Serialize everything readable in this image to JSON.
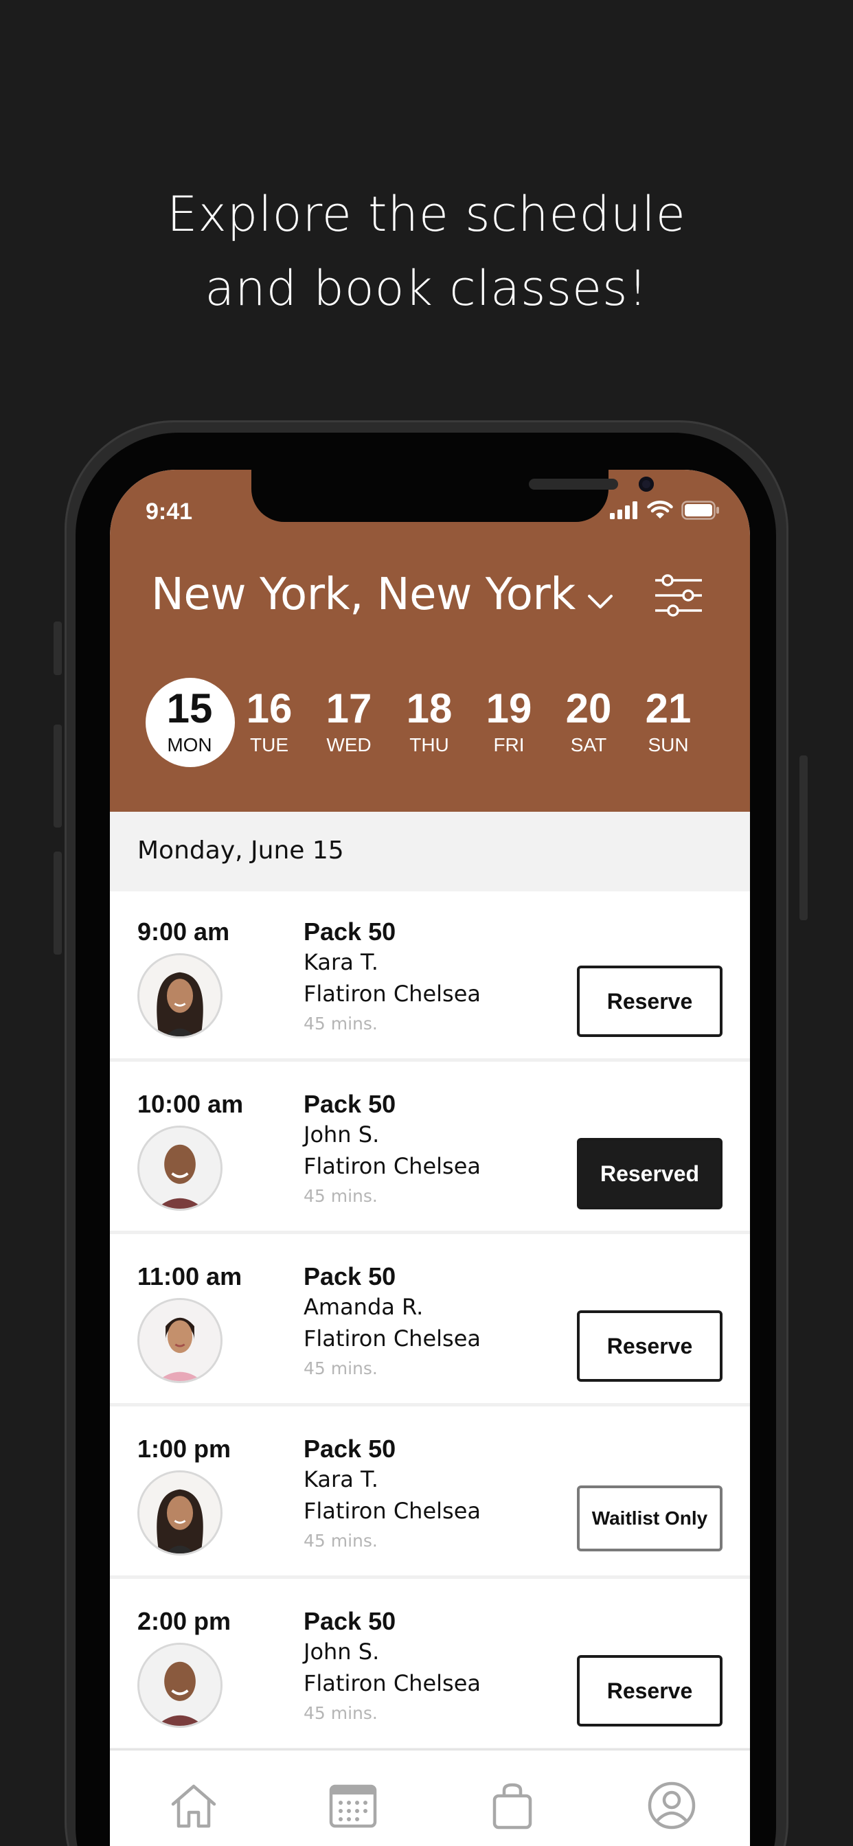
{
  "headline": {
    "line1": "Explore the schedule",
    "line2": "and book classes!"
  },
  "status_bar": {
    "time": "9:41",
    "icons": [
      "signal-icon",
      "wifi-icon",
      "battery-icon"
    ]
  },
  "header": {
    "city": "New York, New York",
    "dropdown_icon": "chevron-down-icon",
    "filter_icon": "filter-sliders-icon"
  },
  "days": [
    {
      "num": "15",
      "dow": "MON",
      "selected": true
    },
    {
      "num": "16",
      "dow": "TUE"
    },
    {
      "num": "17",
      "dow": "WED"
    },
    {
      "num": "18",
      "dow": "THU"
    },
    {
      "num": "19",
      "dow": "FRI"
    },
    {
      "num": "20",
      "dow": "SAT"
    },
    {
      "num": "21",
      "dow": "SUN"
    }
  ],
  "date_label": "Monday, June 15",
  "classes": [
    {
      "time": "9:00 am",
      "name": "Pack 50",
      "instructor": "Kara T.",
      "location": "Flatiron Chelsea",
      "duration": "45 mins.",
      "action": "Reserve"
    },
    {
      "time": "10:00 am",
      "name": "Pack 50",
      "instructor": "John S.",
      "location": "Flatiron Chelsea",
      "duration": "45 mins.",
      "action": "Reserved"
    },
    {
      "time": "11:00 am",
      "name": "Pack 50",
      "instructor": "Amanda R.",
      "location": "Flatiron Chelsea",
      "duration": "45 mins.",
      "action": "Reserve"
    },
    {
      "time": "1:00 pm",
      "name": "Pack 50",
      "instructor": "Kara T.",
      "location": "Flatiron Chelsea",
      "duration": "45 mins.",
      "action": "Waitlist Only"
    },
    {
      "time": "2:00 pm",
      "name": "Pack 50",
      "instructor": "John S.",
      "location": "Flatiron Chelsea",
      "duration": "45 mins.",
      "action": "Reserve"
    }
  ],
  "tabbar": {
    "icons": [
      "home-icon",
      "calendar-icon",
      "shopping-bag-icon",
      "profile-icon"
    ]
  },
  "colors": {
    "brand": "#95593a",
    "background": "#1c1c1c",
    "reserved_button": "#1c1c1c",
    "date_bar": "#f2f2f2"
  }
}
